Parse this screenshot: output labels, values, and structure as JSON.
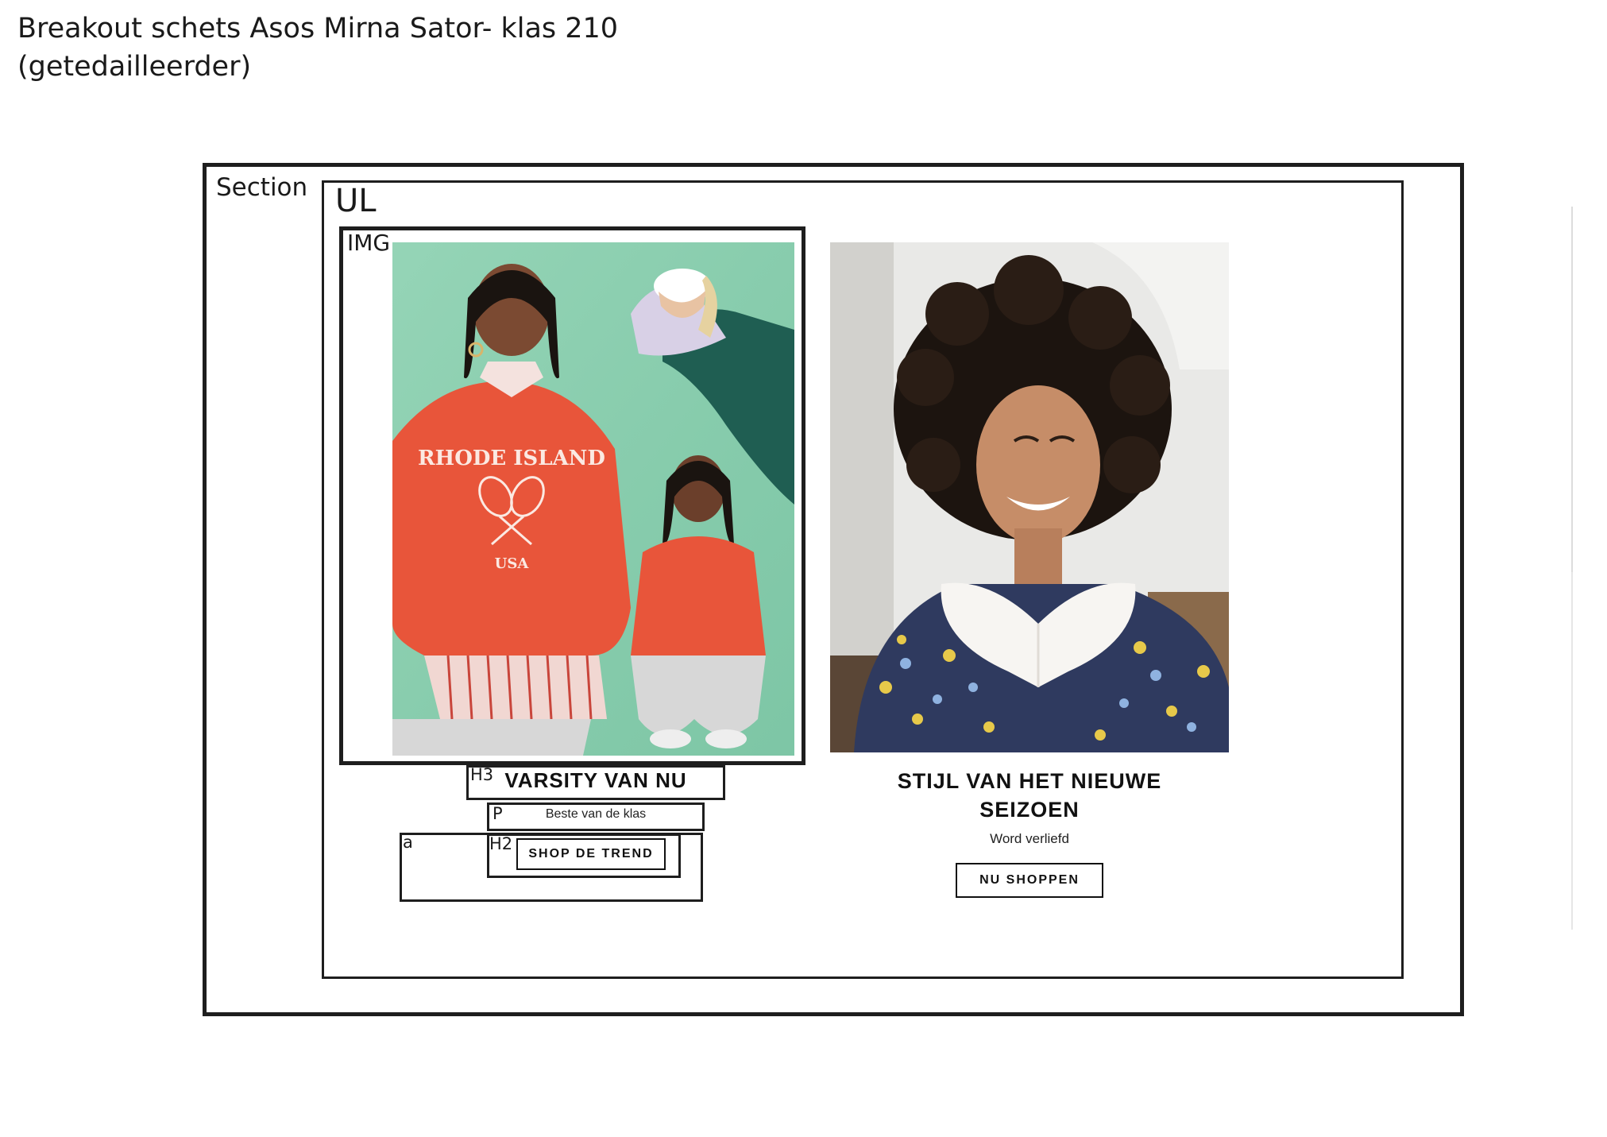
{
  "page_title": {
    "line1": "Breakout schets Asos  Mirna Sator- klas 210",
    "line2": "(getedailleerder)"
  },
  "labels": {
    "section": "Section",
    "ul": "UL",
    "img": "IMG",
    "h3": "H3",
    "p": "P",
    "a": "a",
    "h2": "H2"
  },
  "card1": {
    "heading": "VARSITY VAN NU",
    "paragraph": "Beste van de klas",
    "button": "SHOP DE TREND",
    "sweatshirt_text": "RHODE ISLAND",
    "sweatshirt_sub": "USA"
  },
  "card2": {
    "heading_line1": "STIJL VAN HET NIEUWE",
    "heading_line2": "SEIZOEN",
    "paragraph": "Word verliefd",
    "button": "NU SHOPPEN"
  },
  "colors": {
    "mint_background": "#8ccfb0",
    "sweatshirt": "#e8553a",
    "frame": "#1e1e1e"
  }
}
